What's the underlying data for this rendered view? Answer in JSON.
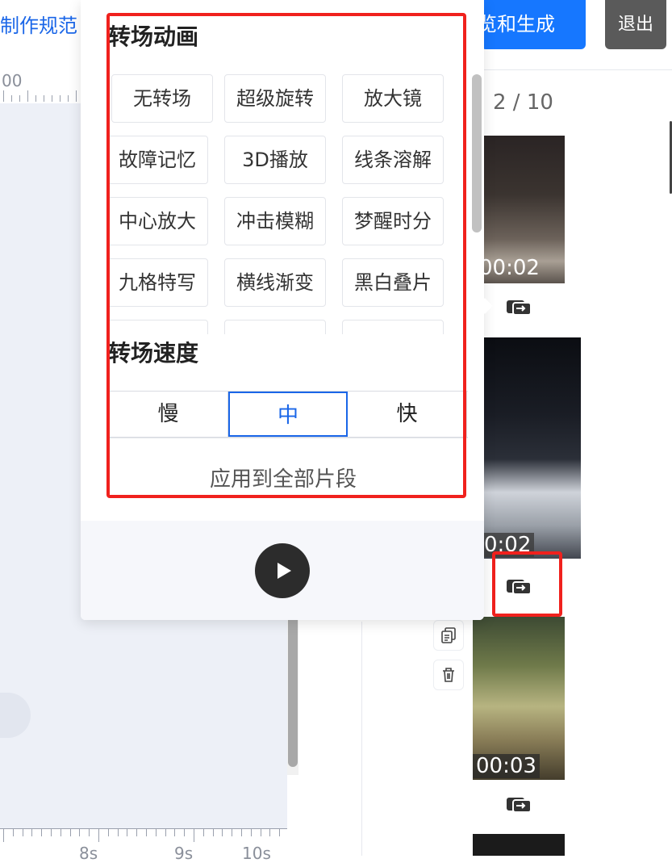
{
  "header": {
    "page_link": "制作规范",
    "primary_button": "预览和生成",
    "exit_button": "退出"
  },
  "ruler": {
    "top_label": "00",
    "bottom_labels": [
      "8s",
      "9s",
      "10s"
    ]
  },
  "timeline": {
    "page_indicator": "2 / 10",
    "clips": [
      {
        "time": "00:02"
      },
      {
        "time": "0:02"
      },
      {
        "time": "00:03"
      }
    ],
    "copy_icon": "copy-icon",
    "delete_icon": "trash-icon",
    "swap_icon": "transition-swap-icon"
  },
  "transition_popup": {
    "anim_title": "转场动画",
    "animations": [
      "无转场",
      "超级旋转",
      "放大镜",
      "故障记忆",
      "3D播放",
      "线条溶解",
      "中心放大",
      "冲击模糊",
      "梦醒时分",
      "九格特写",
      "横线渐变",
      "黑白叠片"
    ],
    "speed_title": "转场速度",
    "speed_options": {
      "slow": "慢",
      "mid": "中",
      "fast": "快"
    },
    "selected_speed": "中",
    "apply_all": "应用到全部片段",
    "play_icon": "play-icon"
  },
  "colors": {
    "accent": "#1677ff",
    "highlight": "#f0211d"
  }
}
